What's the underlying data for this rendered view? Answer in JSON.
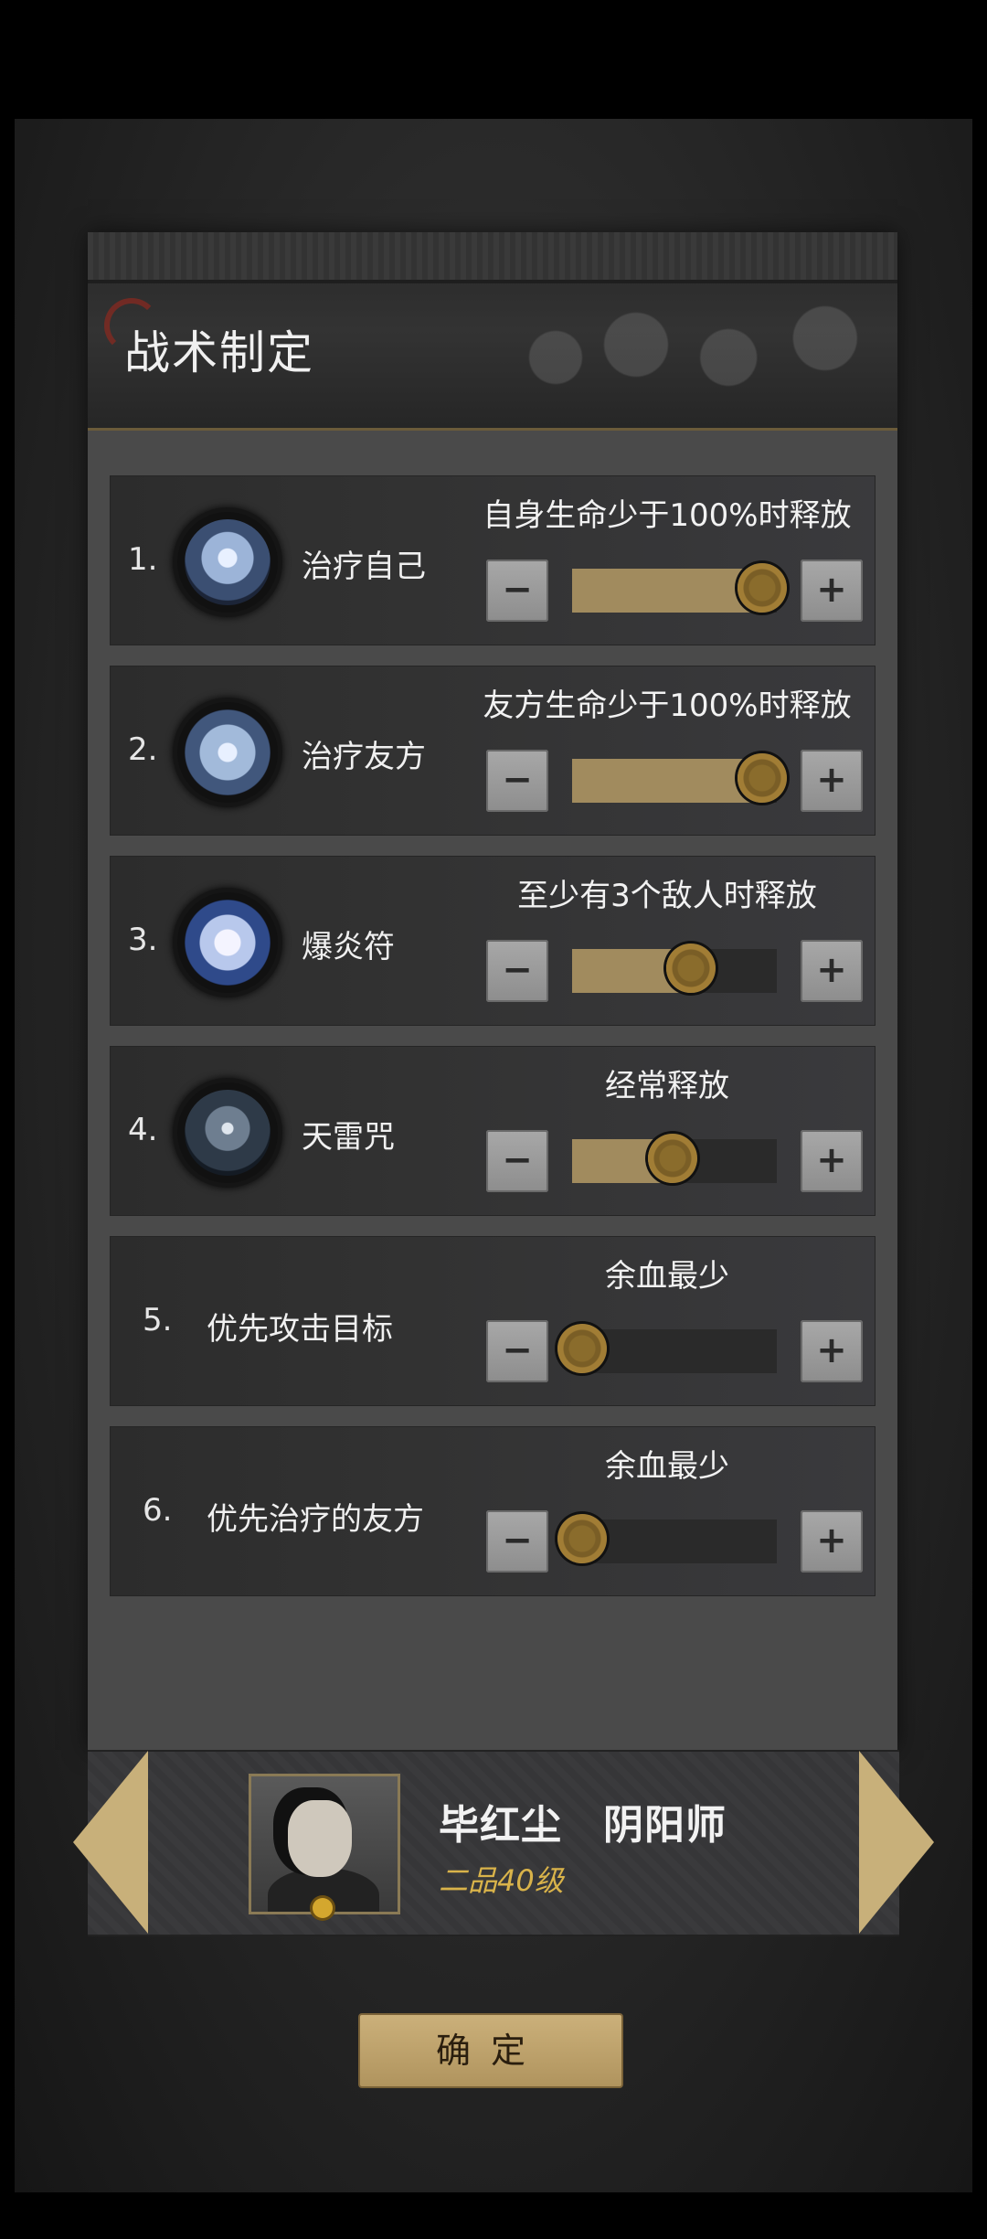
{
  "panel": {
    "title": "战术制定"
  },
  "rows": [
    {
      "number": "1.",
      "name": "治疗自己",
      "condition": "自身生命少于100%时释放",
      "level": 0.93,
      "icon": "heal-self-icon"
    },
    {
      "number": "2.",
      "name": "治疗友方",
      "condition": "友方生命少于100%时释放",
      "level": 0.93,
      "icon": "heal-ally-icon"
    },
    {
      "number": "3.",
      "name": "爆炎符",
      "condition": "至少有3个敌人时释放",
      "level": 0.58,
      "icon": "fire-talisman-icon"
    },
    {
      "number": "4.",
      "name": "天雷咒",
      "condition": "经常释放",
      "level": 0.49,
      "icon": "thunder-curse-icon"
    },
    {
      "number": "5.",
      "name": "优先攻击目标",
      "condition": "余血最少",
      "level": 0.05
    },
    {
      "number": "6.",
      "name": "优先治疗的友方",
      "condition": "余血最少",
      "level": 0.05
    }
  ],
  "controls": {
    "minus": "−",
    "plus": "+"
  },
  "character": {
    "name": "毕红尘　阴阳师",
    "rank": "二品40级"
  },
  "confirm": {
    "label": "确定"
  },
  "colors": {
    "accent": "#a18b5e",
    "rank": "#d9b34a"
  }
}
